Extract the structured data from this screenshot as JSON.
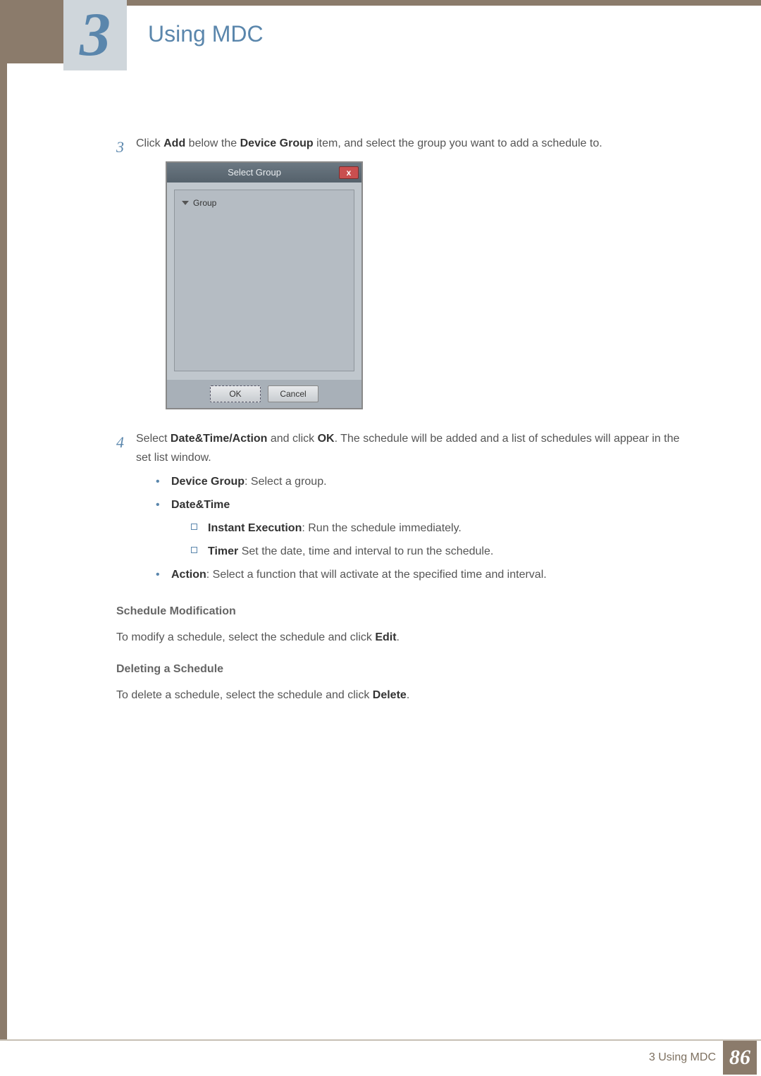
{
  "chapter": {
    "number": "3",
    "title": "Using MDC"
  },
  "steps": {
    "s3": {
      "num": "3",
      "text_pre": "Click ",
      "add": "Add",
      "text_mid": " below the ",
      "device_group": "Device Group",
      "text_post": " item, and select the group you want to add a schedule to."
    },
    "s4": {
      "num": "4",
      "text_pre": "Select ",
      "dta": "Date&Time/Action",
      "text_mid": " and click ",
      "ok": "OK",
      "text_post": ". The schedule will be added and a list of schedules will appear in the set list window."
    }
  },
  "dialog": {
    "title": "Select Group",
    "tree_root": "Group",
    "ok": "OK",
    "cancel": "Cancel",
    "close": "x"
  },
  "bullets": {
    "dg_label": "Device Group",
    "dg_text": ": Select a group.",
    "dt_label": "Date&Time",
    "ie_label": "Instant Execution",
    "ie_text": ": Run the schedule immediately.",
    "timer_label": "Timer",
    "timer_text": " Set the date, time and interval to run the schedule.",
    "action_label": "Action",
    "action_text": ": Select a function that will activate at the specified time and interval."
  },
  "sched_mod": {
    "head": "Schedule Modification",
    "text_pre": "To modify a schedule, select the schedule and click ",
    "edit": "Edit",
    "text_post": "."
  },
  "del_sched": {
    "head": "Deleting a Schedule",
    "text_pre": "To delete a schedule, select the schedule and click ",
    "delete": "Delete",
    "text_post": "."
  },
  "footer": {
    "label_pre": "3 ",
    "label": "Using MDC",
    "page": "86"
  }
}
